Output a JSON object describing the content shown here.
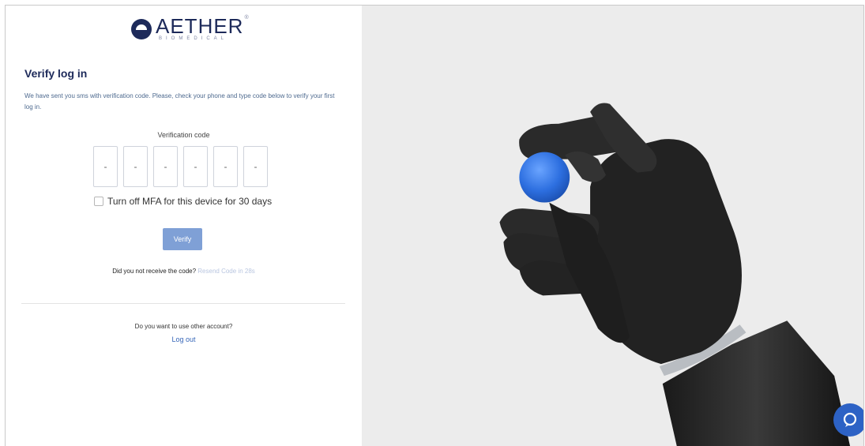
{
  "brand": {
    "name": "AETHER",
    "subtitle": "BIOMEDICAL",
    "trademark": "®"
  },
  "form": {
    "title": "Verify log in",
    "description": "We have sent you sms with verification code. Please, check your phone and type code below to verify your first log in.",
    "code_label": "Verification code",
    "code_placeholders": [
      "-",
      "-",
      "-",
      "-",
      "-",
      "-"
    ],
    "mfa_label": "Turn off MFA for this device for 30 days",
    "mfa_checked": false,
    "verify_button": "Verify",
    "resend_question": "Did you not receive the code?",
    "resend_link": "Resend Code in 28s",
    "other_account_question": "Do you want to use other account?",
    "logout_link": "Log out"
  },
  "hero": {
    "subject": "prosthetic-hand-holding-blue-ball"
  },
  "chat": {
    "icon": "chat-bubble-icon"
  },
  "colors": {
    "brand_navy": "#1d2a5a",
    "accent_blue": "#2d62c5",
    "button_disabled": "#7fa0d6",
    "link_muted": "#b9c6e0"
  }
}
